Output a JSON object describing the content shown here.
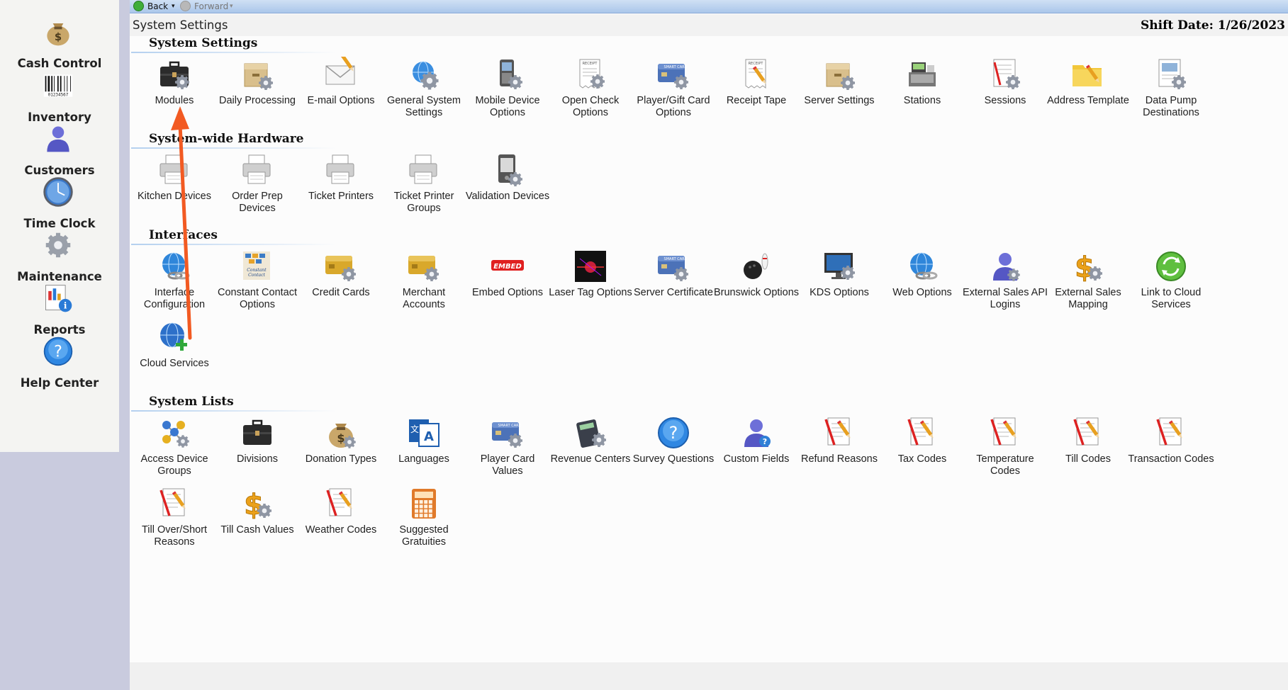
{
  "toolbar": {
    "back_label": "Back",
    "forward_label": "Forward"
  },
  "header": {
    "title": "System Settings",
    "shift_date": "Shift Date: 1/26/2023"
  },
  "sidebar": {
    "items": [
      {
        "label": "Cash Control",
        "icon": "money-bag-icon"
      },
      {
        "label": "Inventory",
        "icon": "barcode-icon"
      },
      {
        "label": "Customers",
        "icon": "person-icon"
      },
      {
        "label": "Time Clock",
        "icon": "clock-icon"
      },
      {
        "label": "Maintenance",
        "icon": "gear-icon"
      },
      {
        "label": "Reports",
        "icon": "report-icon"
      },
      {
        "label": "Help Center",
        "icon": "help-icon"
      }
    ]
  },
  "sections": [
    {
      "title": "System Settings",
      "items": [
        {
          "label": "Modules",
          "icon": "briefcase-gear-icon"
        },
        {
          "label": "Daily Processing",
          "icon": "box-gear-icon"
        },
        {
          "label": "E-mail Options",
          "icon": "envelope-icon"
        },
        {
          "label": "General System Settings",
          "icon": "globe-gear-icon"
        },
        {
          "label": "Mobile Device Options",
          "icon": "phone-gear-icon"
        },
        {
          "label": "Open Check Options",
          "icon": "receipt-gear-icon"
        },
        {
          "label": "Player/Gift Card Options",
          "icon": "card-gear-icon"
        },
        {
          "label": "Receipt Tape",
          "icon": "receipt-pencil-icon"
        },
        {
          "label": "Server Settings",
          "icon": "box-gear-icon"
        },
        {
          "label": "Stations",
          "icon": "cash-register-icon"
        },
        {
          "label": "Sessions",
          "icon": "checklist-gear-icon"
        },
        {
          "label": "Address Template",
          "icon": "folder-pencil-icon"
        },
        {
          "label": "Data Pump Destinations",
          "icon": "document-gear-icon"
        }
      ]
    },
    {
      "title": "System-wide Hardware",
      "items": [
        {
          "label": "Kitchen Devices",
          "icon": "printer-icon"
        },
        {
          "label": "Order Prep Devices",
          "icon": "printer-icon"
        },
        {
          "label": "Ticket Printers",
          "icon": "printer-icon"
        },
        {
          "label": "Ticket Printer Groups",
          "icon": "printer-icon"
        },
        {
          "label": "Validation Devices",
          "icon": "device-gear-icon"
        }
      ]
    },
    {
      "title": "Interfaces",
      "items": [
        {
          "label": "Interface Configuration",
          "icon": "globe-link-icon"
        },
        {
          "label": "Constant Contact Options",
          "icon": "constant-contact-icon"
        },
        {
          "label": "Credit Cards",
          "icon": "gold-card-icon"
        },
        {
          "label": "Merchant Accounts",
          "icon": "gold-card-icon"
        },
        {
          "label": "Embed Options",
          "icon": "embed-logo-icon"
        },
        {
          "label": "Laser Tag Options",
          "icon": "laser-tag-icon"
        },
        {
          "label": "Server Certificate",
          "icon": "card-gear-icon"
        },
        {
          "label": "Brunswick Options",
          "icon": "bowling-icon"
        },
        {
          "label": "KDS Options",
          "icon": "monitor-gear-icon"
        },
        {
          "label": "Web Options",
          "icon": "globe-link-icon"
        },
        {
          "label": "External Sales API Logins",
          "icon": "person-gear-icon"
        },
        {
          "label": "External Sales Mapping",
          "icon": "dollar-gear-icon"
        },
        {
          "label": "Link to Cloud Services",
          "icon": "recycle-globe-icon"
        },
        {
          "label": "Cloud Services",
          "icon": "globe-plus-icon"
        }
      ]
    },
    {
      "title": "System Lists",
      "items": [
        {
          "label": "Access Device Groups",
          "icon": "molecule-gear-icon"
        },
        {
          "label": "Divisions",
          "icon": "briefcase-icon"
        },
        {
          "label": "Donation Types",
          "icon": "money-bag-gear-icon"
        },
        {
          "label": "Languages",
          "icon": "languages-icon"
        },
        {
          "label": "Player Card Values",
          "icon": "card-gear-icon"
        },
        {
          "label": "Revenue Centers",
          "icon": "calculator-gear-icon"
        },
        {
          "label": "Survey Questions",
          "icon": "question-icon"
        },
        {
          "label": "Custom Fields",
          "icon": "person-question-icon"
        },
        {
          "label": "Refund Reasons",
          "icon": "checklist-pencil-icon"
        },
        {
          "label": "Tax Codes",
          "icon": "checklist-pencil-icon"
        },
        {
          "label": "Temperature Codes",
          "icon": "checklist-pencil-icon"
        },
        {
          "label": "Till Codes",
          "icon": "checklist-pencil-icon"
        },
        {
          "label": "Transaction Codes",
          "icon": "checklist-pencil-icon"
        },
        {
          "label": "Till Over/Short Reasons",
          "icon": "checklist-pencil-icon"
        },
        {
          "label": "Till Cash Values",
          "icon": "dollar-gear-icon"
        },
        {
          "label": "Weather Codes",
          "icon": "checklist-pencil-icon"
        },
        {
          "label": "Suggested Gratuities",
          "icon": "calculator-icon"
        }
      ]
    }
  ],
  "colors": {
    "accent_arrow": "#f25a22",
    "section_line": "#b4d0ef",
    "sidebar_bg": "#f4f4f2",
    "page_bg": "#c9cbde",
    "toolbar": "#aac6ea"
  }
}
